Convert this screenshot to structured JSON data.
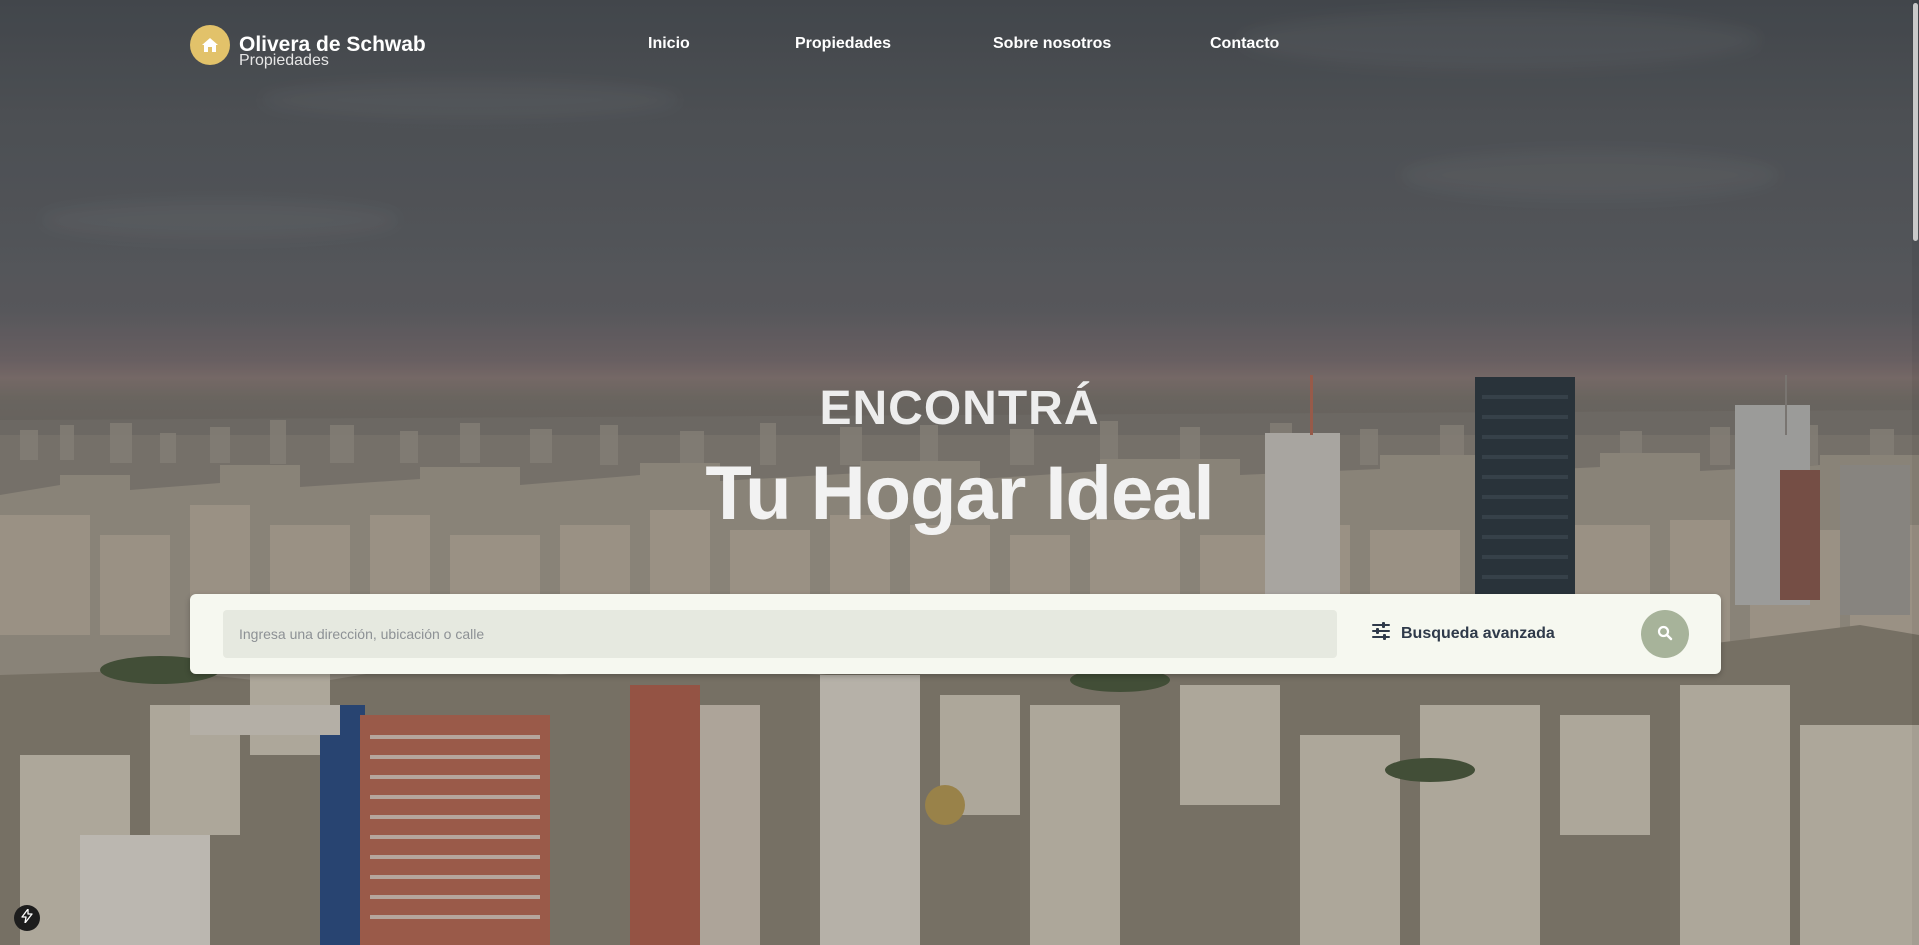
{
  "brand": {
    "name": "Olivera de Schwab",
    "subtitle": "Propiedades",
    "icon": "home-icon"
  },
  "nav": {
    "items": [
      {
        "label": "Inicio"
      },
      {
        "label": "Propiedades"
      },
      {
        "label": "Sobre nosotros"
      },
      {
        "label": "Contacto"
      }
    ]
  },
  "hero": {
    "kicker": "ENCONTRÁ",
    "headline": "Tu Hogar Ideal"
  },
  "search": {
    "placeholder": "Ingresa una dirección, ubicación o calle",
    "value": "",
    "advanced_label": "Busqueda avanzada",
    "advanced_icon": "sliders-icon",
    "button_icon": "search-icon"
  },
  "colors": {
    "brand_accent": "#e2c26a",
    "search_button": "#a7b39a",
    "search_card": "#f6f8f0",
    "search_input_bg": "#e6e9e0",
    "advanced_label": "#2f3a4a"
  },
  "widget": {
    "icon": "lightning-bolt-icon"
  }
}
